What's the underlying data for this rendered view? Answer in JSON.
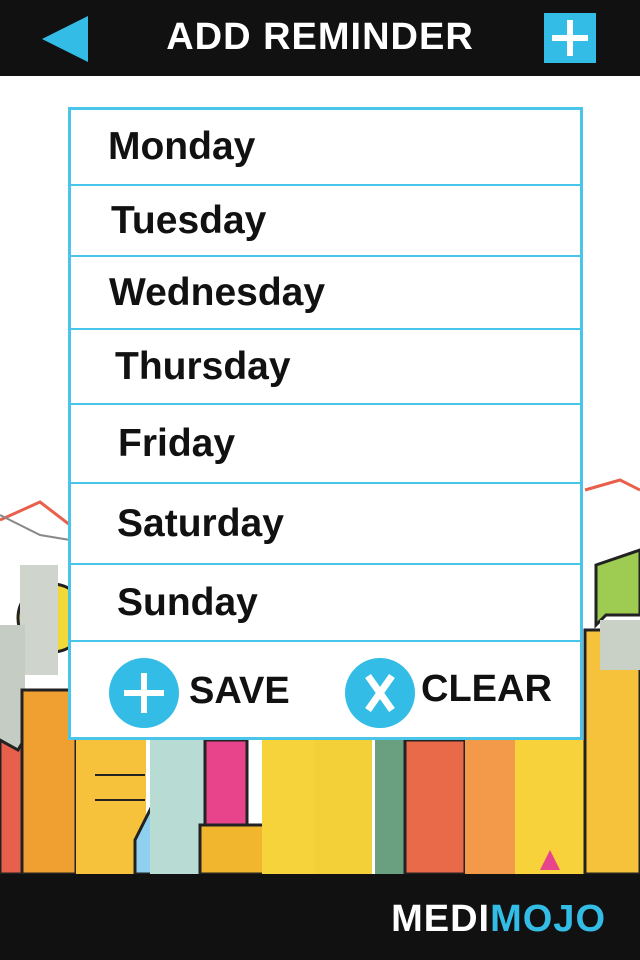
{
  "header": {
    "title": "ADD REMINDER",
    "back_icon": "back-arrow-icon",
    "add_icon": "plus-icon"
  },
  "days": [
    {
      "label": "Monday"
    },
    {
      "label": "Tuesday"
    },
    {
      "label": "Wednesday"
    },
    {
      "label": "Thursday"
    },
    {
      "label": "Friday"
    },
    {
      "label": "Saturday"
    },
    {
      "label": "Sunday"
    }
  ],
  "actions": {
    "save_label": "SAVE",
    "save_icon": "plus-circle-icon",
    "clear_label": "CLEAR",
    "clear_icon": "x-circle-icon"
  },
  "footer": {
    "brand_part1": "MEDI",
    "brand_part2": "MOJO"
  },
  "colors": {
    "accent": "#33bde6",
    "bar": "#111111",
    "panel_border": "#49c5ea"
  }
}
